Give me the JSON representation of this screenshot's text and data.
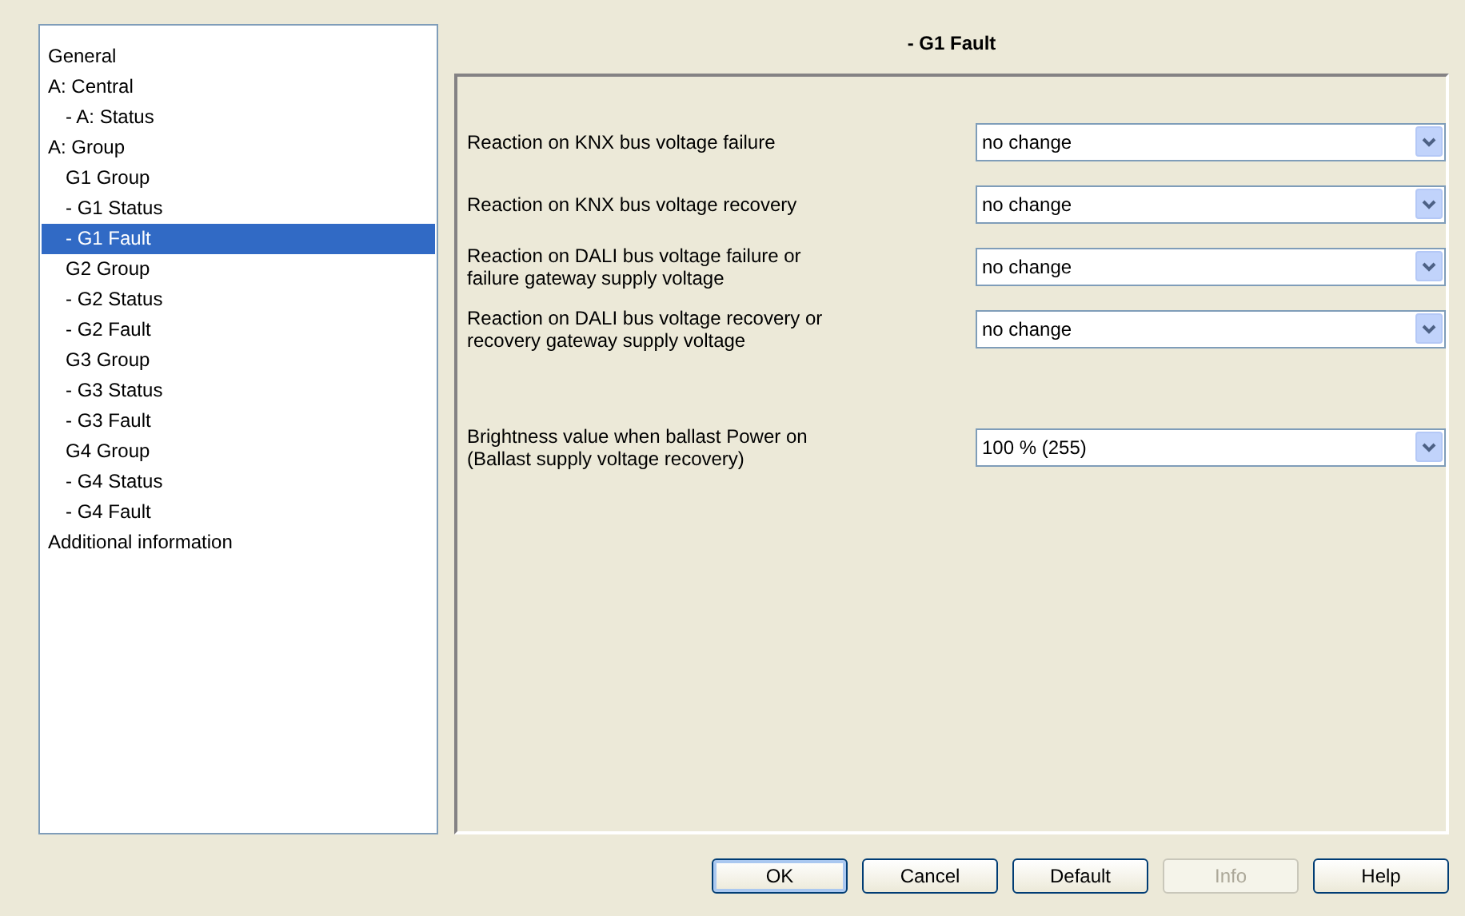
{
  "tree": [
    {
      "label": "General",
      "selected": false
    },
    {
      "label": "A: Central",
      "selected": false,
      "children": [
        {
          "label": "- A: Status",
          "selected": false
        }
      ]
    },
    {
      "label": "A: Group",
      "selected": false,
      "children": [
        {
          "label": "G1 Group",
          "selected": false
        },
        {
          "label": "- G1 Status",
          "selected": false
        },
        {
          "label": "- G1 Fault",
          "selected": true
        },
        {
          "label": "G2 Group",
          "selected": false
        },
        {
          "label": "- G2 Status",
          "selected": false
        },
        {
          "label": "- G2 Fault",
          "selected": false
        },
        {
          "label": "G3 Group",
          "selected": false
        },
        {
          "label": "- G3 Status",
          "selected": false
        },
        {
          "label": "- G3 Fault",
          "selected": false
        },
        {
          "label": "G4 Group",
          "selected": false
        },
        {
          "label": "- G4 Status",
          "selected": false
        },
        {
          "label": "- G4 Fault",
          "selected": false
        }
      ]
    },
    {
      "label": "Additional information",
      "selected": false
    }
  ],
  "page_title": "- G1 Fault",
  "parameter_groups": [
    [
      {
        "label": "Reaction on KNX bus voltage failure",
        "value": "no change"
      },
      {
        "label": "Reaction on KNX bus voltage recovery",
        "value": "no change"
      },
      {
        "label": "Reaction on DALI bus voltage failure or failure gateway supply voltage",
        "value": "no change"
      },
      {
        "label": "Reaction on DALI bus voltage recovery or recovery gateway supply voltage",
        "value": "no change"
      }
    ],
    [
      {
        "label": "Brightness value when ballast Power on (Ballast supply voltage recovery)",
        "value": "100 % (255)"
      }
    ]
  ],
  "buttons": [
    {
      "label": "OK",
      "disabled": false,
      "default": true
    },
    {
      "label": "Cancel",
      "disabled": false,
      "default": false
    },
    {
      "label": "Default",
      "disabled": false,
      "default": false
    },
    {
      "label": "Info",
      "disabled": true,
      "default": false
    },
    {
      "label": "Help",
      "disabled": false,
      "default": false
    }
  ]
}
